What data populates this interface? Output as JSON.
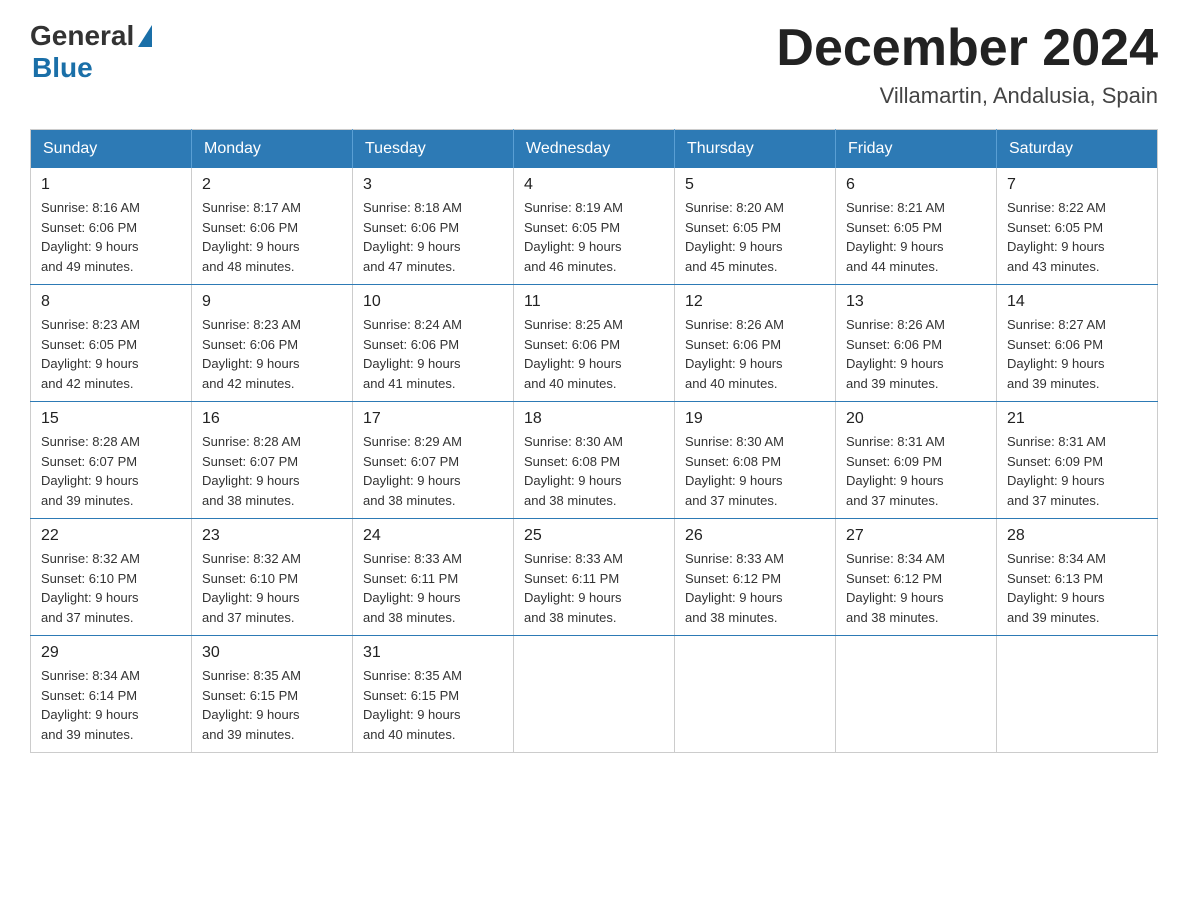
{
  "logo": {
    "general": "General",
    "blue": "Blue"
  },
  "title": {
    "month": "December 2024",
    "location": "Villamartin, Andalusia, Spain"
  },
  "headers": [
    "Sunday",
    "Monday",
    "Tuesday",
    "Wednesday",
    "Thursday",
    "Friday",
    "Saturday"
  ],
  "weeks": [
    [
      {
        "day": "1",
        "sunrise": "8:16 AM",
        "sunset": "6:06 PM",
        "daylight": "9 hours and 49 minutes."
      },
      {
        "day": "2",
        "sunrise": "8:17 AM",
        "sunset": "6:06 PM",
        "daylight": "9 hours and 48 minutes."
      },
      {
        "day": "3",
        "sunrise": "8:18 AM",
        "sunset": "6:06 PM",
        "daylight": "9 hours and 47 minutes."
      },
      {
        "day": "4",
        "sunrise": "8:19 AM",
        "sunset": "6:05 PM",
        "daylight": "9 hours and 46 minutes."
      },
      {
        "day": "5",
        "sunrise": "8:20 AM",
        "sunset": "6:05 PM",
        "daylight": "9 hours and 45 minutes."
      },
      {
        "day": "6",
        "sunrise": "8:21 AM",
        "sunset": "6:05 PM",
        "daylight": "9 hours and 44 minutes."
      },
      {
        "day": "7",
        "sunrise": "8:22 AM",
        "sunset": "6:05 PM",
        "daylight": "9 hours and 43 minutes."
      }
    ],
    [
      {
        "day": "8",
        "sunrise": "8:23 AM",
        "sunset": "6:05 PM",
        "daylight": "9 hours and 42 minutes."
      },
      {
        "day": "9",
        "sunrise": "8:23 AM",
        "sunset": "6:06 PM",
        "daylight": "9 hours and 42 minutes."
      },
      {
        "day": "10",
        "sunrise": "8:24 AM",
        "sunset": "6:06 PM",
        "daylight": "9 hours and 41 minutes."
      },
      {
        "day": "11",
        "sunrise": "8:25 AM",
        "sunset": "6:06 PM",
        "daylight": "9 hours and 40 minutes."
      },
      {
        "day": "12",
        "sunrise": "8:26 AM",
        "sunset": "6:06 PM",
        "daylight": "9 hours and 40 minutes."
      },
      {
        "day": "13",
        "sunrise": "8:26 AM",
        "sunset": "6:06 PM",
        "daylight": "9 hours and 39 minutes."
      },
      {
        "day": "14",
        "sunrise": "8:27 AM",
        "sunset": "6:06 PM",
        "daylight": "9 hours and 39 minutes."
      }
    ],
    [
      {
        "day": "15",
        "sunrise": "8:28 AM",
        "sunset": "6:07 PM",
        "daylight": "9 hours and 39 minutes."
      },
      {
        "day": "16",
        "sunrise": "8:28 AM",
        "sunset": "6:07 PM",
        "daylight": "9 hours and 38 minutes."
      },
      {
        "day": "17",
        "sunrise": "8:29 AM",
        "sunset": "6:07 PM",
        "daylight": "9 hours and 38 minutes."
      },
      {
        "day": "18",
        "sunrise": "8:30 AM",
        "sunset": "6:08 PM",
        "daylight": "9 hours and 38 minutes."
      },
      {
        "day": "19",
        "sunrise": "8:30 AM",
        "sunset": "6:08 PM",
        "daylight": "9 hours and 37 minutes."
      },
      {
        "day": "20",
        "sunrise": "8:31 AM",
        "sunset": "6:09 PM",
        "daylight": "9 hours and 37 minutes."
      },
      {
        "day": "21",
        "sunrise": "8:31 AM",
        "sunset": "6:09 PM",
        "daylight": "9 hours and 37 minutes."
      }
    ],
    [
      {
        "day": "22",
        "sunrise": "8:32 AM",
        "sunset": "6:10 PM",
        "daylight": "9 hours and 37 minutes."
      },
      {
        "day": "23",
        "sunrise": "8:32 AM",
        "sunset": "6:10 PM",
        "daylight": "9 hours and 37 minutes."
      },
      {
        "day": "24",
        "sunrise": "8:33 AM",
        "sunset": "6:11 PM",
        "daylight": "9 hours and 38 minutes."
      },
      {
        "day": "25",
        "sunrise": "8:33 AM",
        "sunset": "6:11 PM",
        "daylight": "9 hours and 38 minutes."
      },
      {
        "day": "26",
        "sunrise": "8:33 AM",
        "sunset": "6:12 PM",
        "daylight": "9 hours and 38 minutes."
      },
      {
        "day": "27",
        "sunrise": "8:34 AM",
        "sunset": "6:12 PM",
        "daylight": "9 hours and 38 minutes."
      },
      {
        "day": "28",
        "sunrise": "8:34 AM",
        "sunset": "6:13 PM",
        "daylight": "9 hours and 39 minutes."
      }
    ],
    [
      {
        "day": "29",
        "sunrise": "8:34 AM",
        "sunset": "6:14 PM",
        "daylight": "9 hours and 39 minutes."
      },
      {
        "day": "30",
        "sunrise": "8:35 AM",
        "sunset": "6:15 PM",
        "daylight": "9 hours and 39 minutes."
      },
      {
        "day": "31",
        "sunrise": "8:35 AM",
        "sunset": "6:15 PM",
        "daylight": "9 hours and 40 minutes."
      },
      null,
      null,
      null,
      null
    ]
  ],
  "labels": {
    "sunrise": "Sunrise:",
    "sunset": "Sunset:",
    "daylight": "Daylight:"
  }
}
